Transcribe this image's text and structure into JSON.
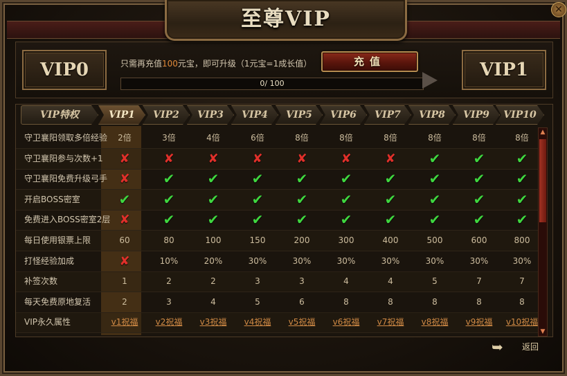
{
  "title": "至尊VIP",
  "close_icon": "close-icon",
  "current_vip": "VIP0",
  "next_vip": "VIP1",
  "message": {
    "prefix": "只需再充值",
    "amount": "100",
    "suffix": "元宝，即可升级（1元宝=1成长值）"
  },
  "recharge_label": "充值",
  "progress": {
    "text": "0/ 100",
    "value": 0,
    "max": 100
  },
  "header_label": "VIP特权",
  "levels": [
    "VIP1",
    "VIP2",
    "VIP3",
    "VIP4",
    "VIP5",
    "VIP6",
    "VIP7",
    "VIP8",
    "VIP9",
    "VIP10"
  ],
  "active_level": "VIP1",
  "rows": [
    {
      "label": "守卫襄阳领取多倍经验",
      "cells": [
        "2倍",
        "3倍",
        "4倍",
        "6倍",
        "8倍",
        "8倍",
        "8倍",
        "8倍",
        "8倍",
        "8倍"
      ]
    },
    {
      "label": "守卫襄阳参与次数+1",
      "cells": [
        "x",
        "x",
        "x",
        "x",
        "x",
        "x",
        "x",
        "v",
        "v",
        "v"
      ]
    },
    {
      "label": "守卫襄阳免费升级弓手",
      "cells": [
        "x",
        "v",
        "v",
        "v",
        "v",
        "v",
        "v",
        "v",
        "v",
        "v"
      ]
    },
    {
      "label": "开启BOSS密室",
      "cells": [
        "v",
        "v",
        "v",
        "v",
        "v",
        "v",
        "v",
        "v",
        "v",
        "v"
      ]
    },
    {
      "label": "免费进入BOSS密室2层",
      "cells": [
        "x",
        "v",
        "v",
        "v",
        "v",
        "v",
        "v",
        "v",
        "v",
        "v"
      ]
    },
    {
      "label": "每日使用银票上限",
      "cells": [
        "60",
        "80",
        "100",
        "150",
        "200",
        "300",
        "400",
        "500",
        "600",
        "800"
      ]
    },
    {
      "label": "打怪经验加成",
      "cells": [
        "x",
        "10%",
        "20%",
        "30%",
        "30%",
        "30%",
        "30%",
        "30%",
        "30%",
        "30%"
      ]
    },
    {
      "label": "补签次数",
      "cells": [
        "1",
        "2",
        "2",
        "3",
        "3",
        "4",
        "4",
        "5",
        "7",
        "7"
      ]
    },
    {
      "label": "每天免费原地复活",
      "cells": [
        "2",
        "3",
        "4",
        "5",
        "6",
        "8",
        "8",
        "8",
        "8",
        "8"
      ]
    },
    {
      "label": "VIP永久属性",
      "cells": [
        "v1祝福",
        "v2祝福",
        "v3祝福",
        "v4祝福",
        "v5祝福",
        "v6祝福",
        "v7祝福",
        "v8祝福",
        "v9祝福",
        "v10祝福"
      ],
      "links": true
    }
  ],
  "icons": {
    "check": "check-icon",
    "cross": "cross-icon",
    "back": "back-arrow-icon"
  },
  "back_label": "返回",
  "colors": {
    "accent": "#e08a3a",
    "check": "#3fd63f",
    "cross": "#e0302a",
    "link": "#d08a45"
  }
}
